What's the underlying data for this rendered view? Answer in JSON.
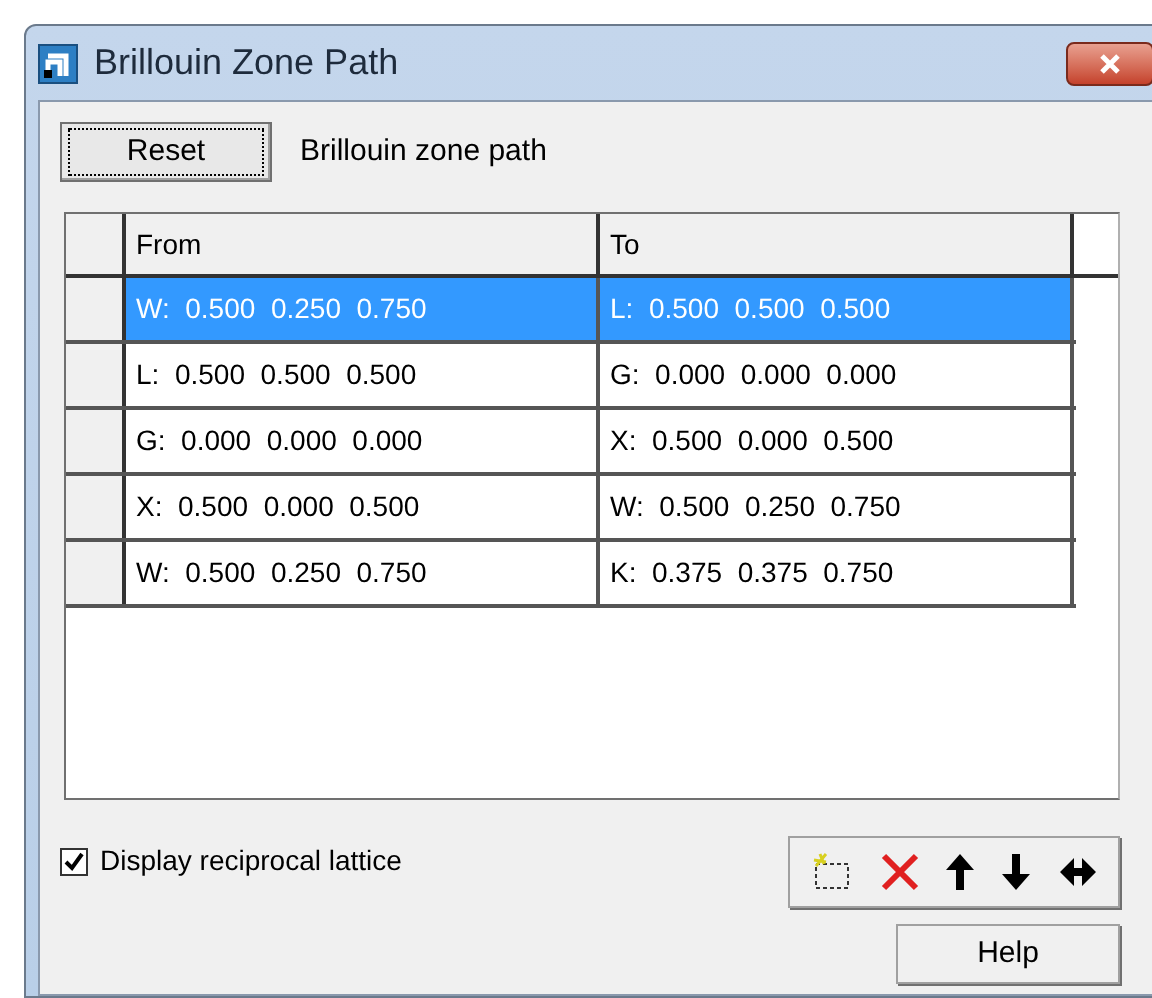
{
  "window": {
    "title": "Brillouin Zone Path"
  },
  "reset_button": "Reset",
  "heading": "Brillouin zone path",
  "table": {
    "columns": [
      "From",
      "To"
    ],
    "rows": [
      {
        "from": "W:  0.500  0.250  0.750",
        "to": "L:  0.500  0.500  0.500",
        "selected": true
      },
      {
        "from": "L:  0.500  0.500  0.500",
        "to": "G:  0.000  0.000  0.000",
        "selected": false
      },
      {
        "from": "G:  0.000  0.000  0.000",
        "to": "X:  0.500  0.000  0.500",
        "selected": false
      },
      {
        "from": "X:  0.500  0.000  0.500",
        "to": "W:  0.500  0.250  0.750",
        "selected": false
      },
      {
        "from": "W:  0.500  0.250  0.750",
        "to": "K:  0.375  0.375  0.750",
        "selected": false
      }
    ]
  },
  "display_reciprocal_lattice": {
    "label": "Display reciprocal lattice",
    "checked": true
  },
  "help_button": "Help"
}
